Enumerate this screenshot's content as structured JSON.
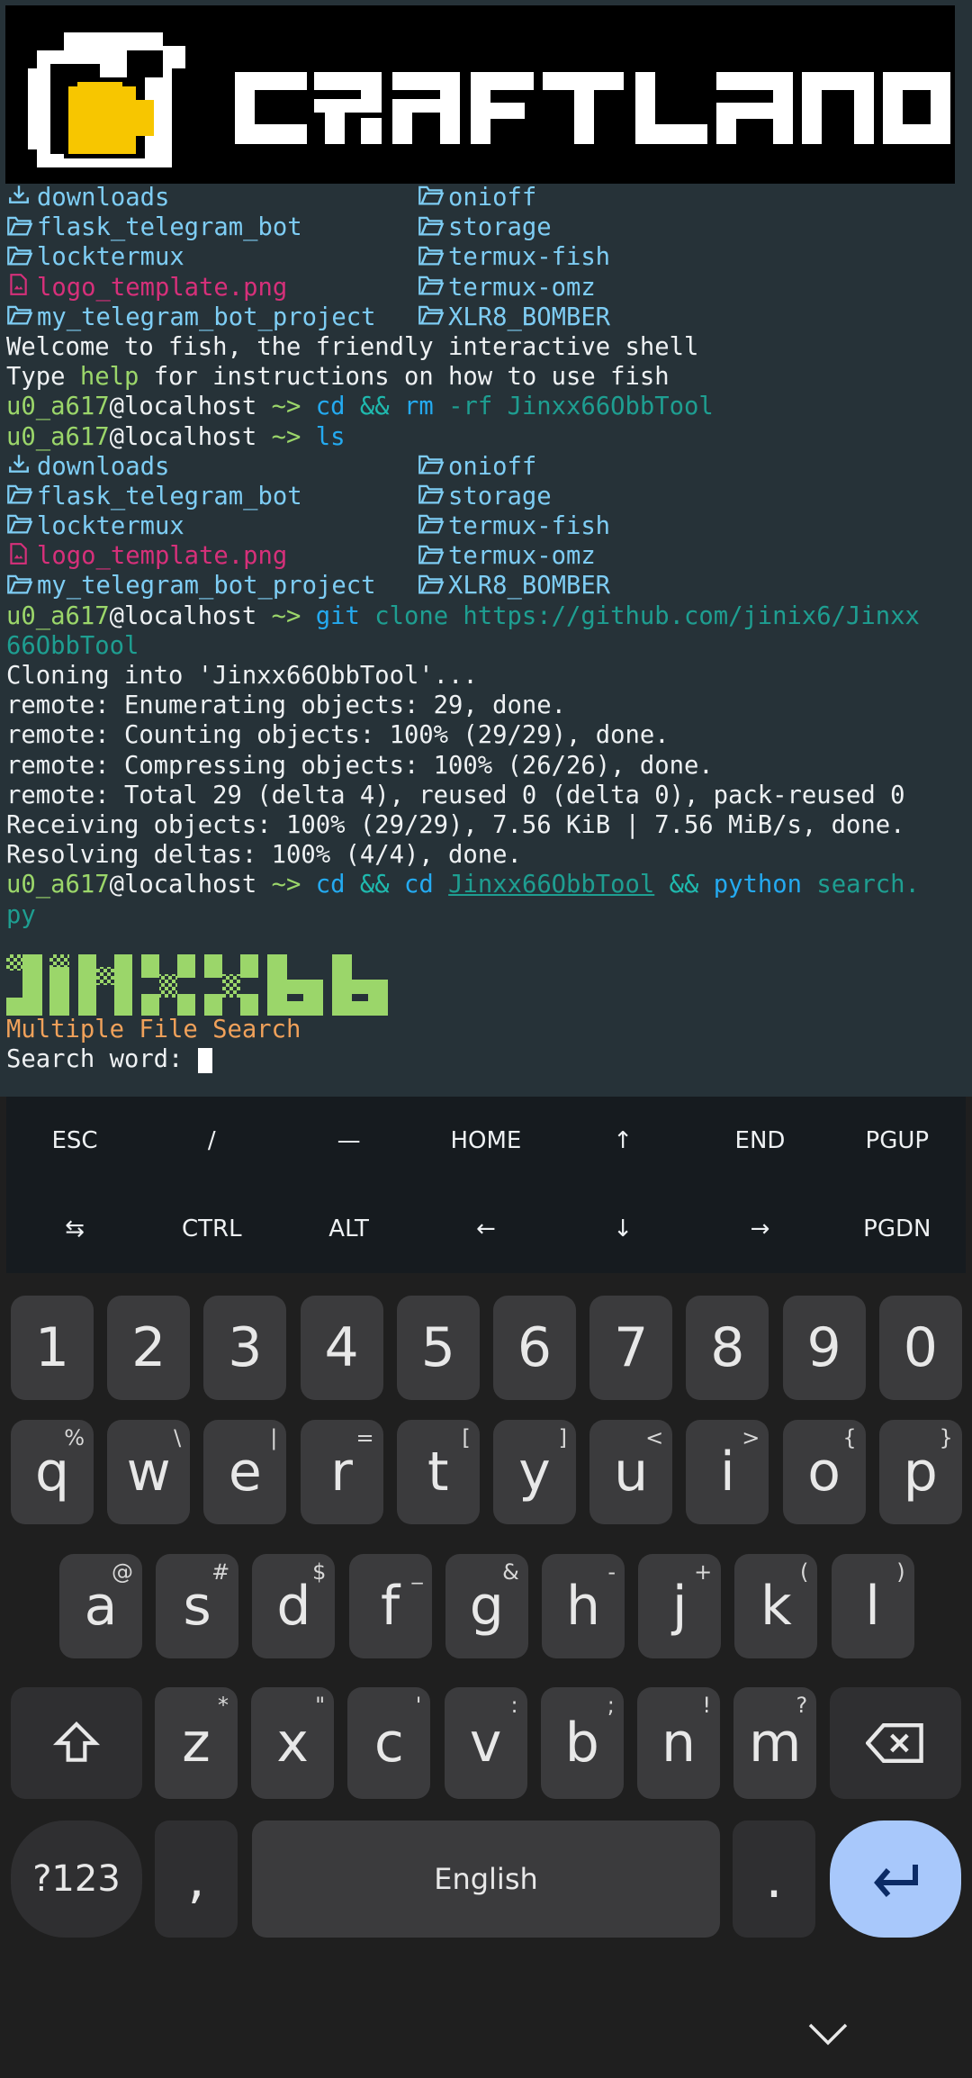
{
  "banner": {
    "logo_text": "CRAFTLAND"
  },
  "listing": [
    {
      "left": {
        "icon": "download-folder-icon",
        "name": "downloads",
        "type": "dir"
      },
      "right": {
        "icon": "folder-icon",
        "name": "onioff",
        "type": "dir"
      }
    },
    {
      "left": {
        "icon": "folder-icon",
        "name": "flask_telegram_bot",
        "type": "dir"
      },
      "right": {
        "icon": "folder-icon",
        "name": "storage",
        "type": "dir"
      }
    },
    {
      "left": {
        "icon": "folder-icon",
        "name": "locktermux",
        "type": "dir"
      },
      "right": {
        "icon": "folder-icon",
        "name": "termux-fish",
        "type": "dir"
      }
    },
    {
      "left": {
        "icon": "image-file-icon",
        "name": "logo_template.png",
        "type": "file"
      },
      "right": {
        "icon": "folder-icon",
        "name": "termux-omz",
        "type": "dir"
      }
    },
    {
      "left": {
        "icon": "folder-icon",
        "name": "my_telegram_bot_project",
        "type": "dir"
      },
      "right": {
        "icon": "folder-icon",
        "name": "XLR8_BOMBER",
        "type": "dir"
      }
    }
  ],
  "terminal": {
    "welcome": "Welcome to fish, the friendly interactive shell",
    "type_help_pre": "Type ",
    "type_help_word": "help",
    "type_help_post": " for instructions on how to use fish",
    "prompt_user": "u0_a617",
    "prompt_host": "@localhost",
    "prompt_dir": " ~> ",
    "cmd1_a": "cd",
    "cmd1_b": " && ",
    "cmd1_c": "rm",
    "cmd1_d": " -rf Jinxx66ObbTool",
    "cmd2": "ls",
    "cmd3_a": "git",
    "cmd3_b": " clone https://github.com/jinix6/Jinxx",
    "cmd3_wrap": "66ObbTool",
    "clone_out": [
      "Cloning into 'Jinxx66ObbTool'...",
      "remote: Enumerating objects: 29, done.",
      "remote: Counting objects: 100% (29/29), done.",
      "remote: Compressing objects: 100% (26/26), done.",
      "remote: Total 29 (delta 4), reused 0 (delta 0), pack-reused 0",
      "Receiving objects: 100% (29/29), 7.56 KiB | 7.56 MiB/s, done.",
      "Resolving deltas: 100% (4/4), done."
    ],
    "cmd4_a": "cd",
    "cmd4_b": " && ",
    "cmd4_c": "cd",
    "cmd4_d": "Jinxx66ObbTool",
    "cmd4_e": " && ",
    "cmd4_f": "python",
    "cmd4_g": " search.",
    "cmd4_wrap": "py",
    "tool_logo": "JINXX66",
    "tool_subtitle": "Multiple File Search",
    "search_prompt": "Search word: "
  },
  "extra_keys": {
    "row1": [
      "ESC",
      "/",
      "—",
      "HOME",
      "↑",
      "END",
      "PGUP"
    ],
    "row2": [
      "⇆",
      "CTRL",
      "ALT",
      "←",
      "↓",
      "→",
      "PGDN"
    ]
  },
  "keyboard": {
    "numbers": [
      "1",
      "2",
      "3",
      "4",
      "5",
      "6",
      "7",
      "8",
      "9",
      "0"
    ],
    "row_q": [
      [
        "q",
        "%"
      ],
      [
        "w",
        "\\"
      ],
      [
        "e",
        "|"
      ],
      [
        "r",
        "="
      ],
      [
        "t",
        "["
      ],
      [
        "y",
        "]"
      ],
      [
        "u",
        "<"
      ],
      [
        "i",
        ">"
      ],
      [
        "o",
        "{"
      ],
      [
        "p",
        "}"
      ]
    ],
    "row_a": [
      [
        "a",
        "@"
      ],
      [
        "s",
        "#"
      ],
      [
        "d",
        "$"
      ],
      [
        "f",
        "_"
      ],
      [
        "g",
        "&"
      ],
      [
        "h",
        "-"
      ],
      [
        "j",
        "+"
      ],
      [
        "k",
        "("
      ],
      [
        "l",
        ")"
      ]
    ],
    "row_z": [
      [
        "z",
        "*"
      ],
      [
        "x",
        "\""
      ],
      [
        "c",
        "'"
      ],
      [
        "v",
        ":"
      ],
      [
        "b",
        ";"
      ],
      [
        "n",
        "!"
      ],
      [
        "m",
        "?"
      ]
    ],
    "symbols_label": "?123",
    "comma": ",",
    "space_label": "English",
    "period": "."
  },
  "colors": {
    "terminal_bg": "#263238",
    "directory": "#7ecdf4",
    "png_file": "#d6307a",
    "prompt_user": "#9bd66a",
    "command": "#24aaf0",
    "argument": "#1e9e91",
    "subtitle": "#f0a15a",
    "keyboard_bg": "#1f1f1f",
    "key": "#3b3b3d",
    "enter_key": "#a8c8fb"
  }
}
